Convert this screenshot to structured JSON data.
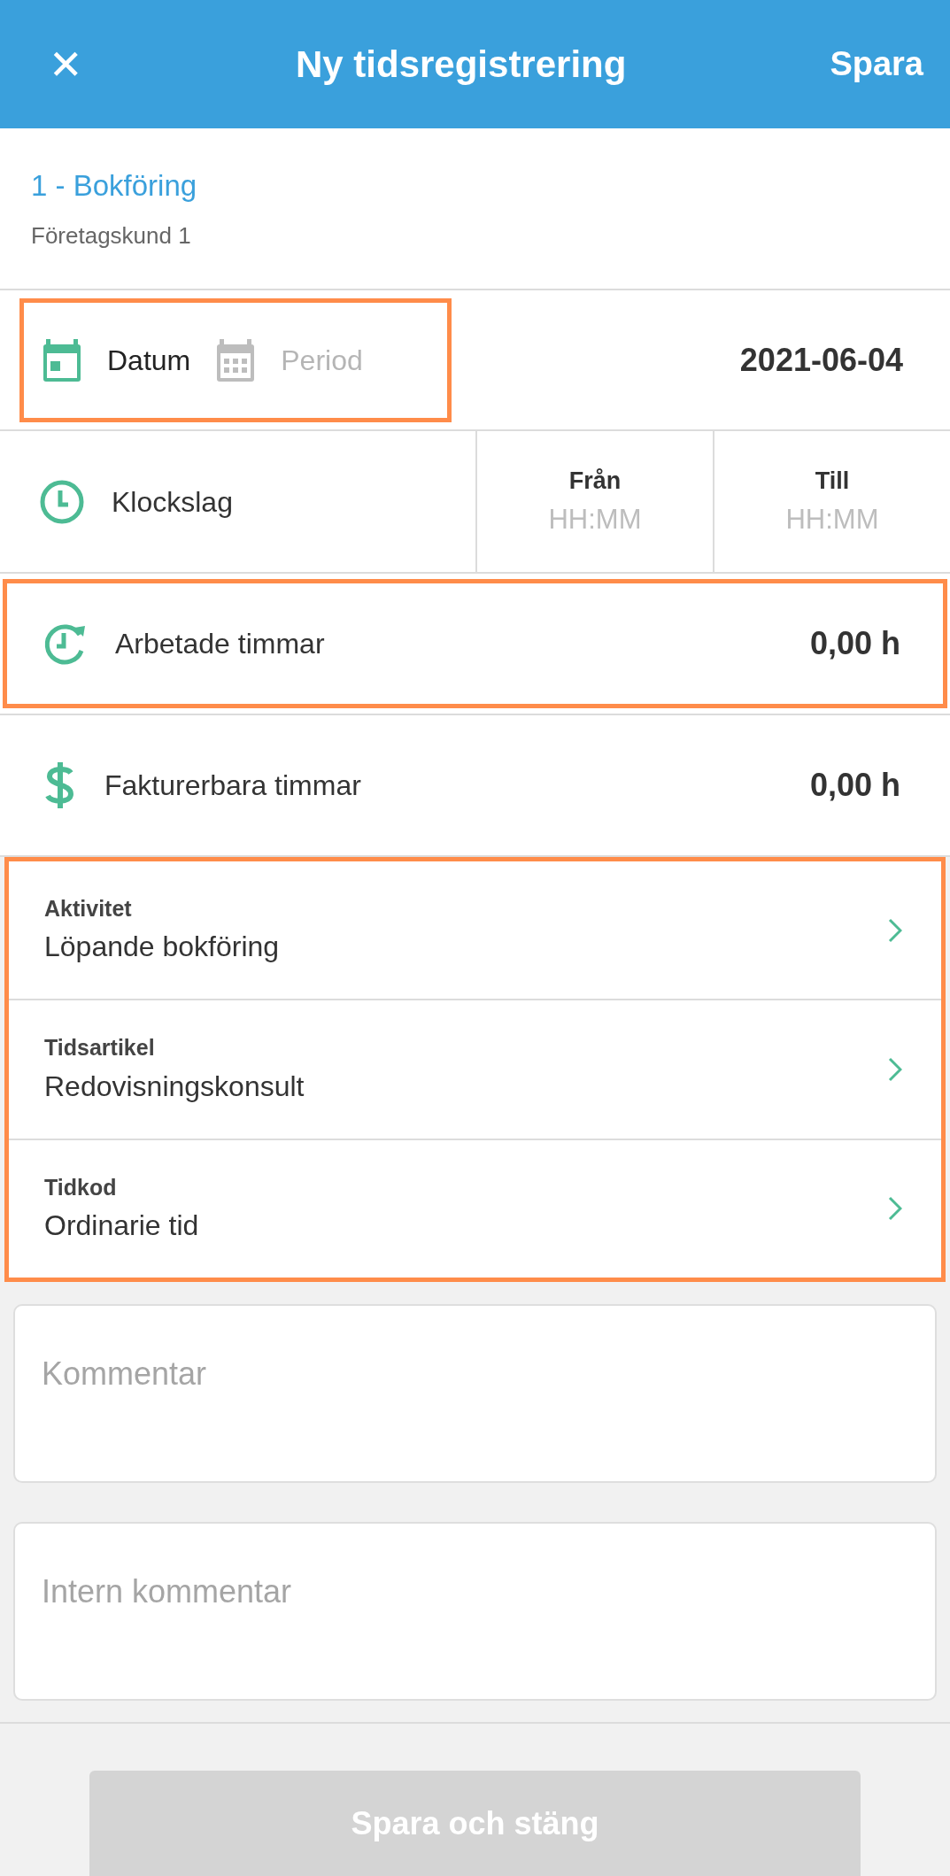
{
  "header": {
    "close": "✕",
    "title": "Ny tidsregistrering",
    "save": "Spara"
  },
  "project": {
    "name": "1 - Bokföring",
    "customer": "Företagskund 1"
  },
  "date_mode": {
    "highlighted": true,
    "options": [
      {
        "label": "Datum",
        "selected": true
      },
      {
        "label": "Period",
        "selected": false
      }
    ],
    "value": "2021-06-04"
  },
  "clock": {
    "label": "Klockslag",
    "from": {
      "label": "Från",
      "placeholder": "HH:MM"
    },
    "to": {
      "label": "Till",
      "placeholder": "HH:MM"
    }
  },
  "hours": [
    {
      "kind": "worked",
      "label": "Arbetade timmar",
      "value": "0,00 h",
      "highlighted": true
    },
    {
      "kind": "billable",
      "label": "Fakturerbara timmar",
      "value": "0,00 h",
      "highlighted": false
    }
  ],
  "selectors": {
    "highlighted": true,
    "items": [
      {
        "label": "Aktivitet",
        "value": "Löpande bokföring"
      },
      {
        "label": "Tidsartikel",
        "value": "Redovisningskonsult"
      },
      {
        "label": "Tidkod",
        "value": "Ordinarie tid"
      }
    ]
  },
  "comments": [
    {
      "placeholder": "Kommentar"
    },
    {
      "placeholder": "Intern kommentar"
    }
  ],
  "submit": {
    "label": "Spara och stäng",
    "disabled": true
  }
}
